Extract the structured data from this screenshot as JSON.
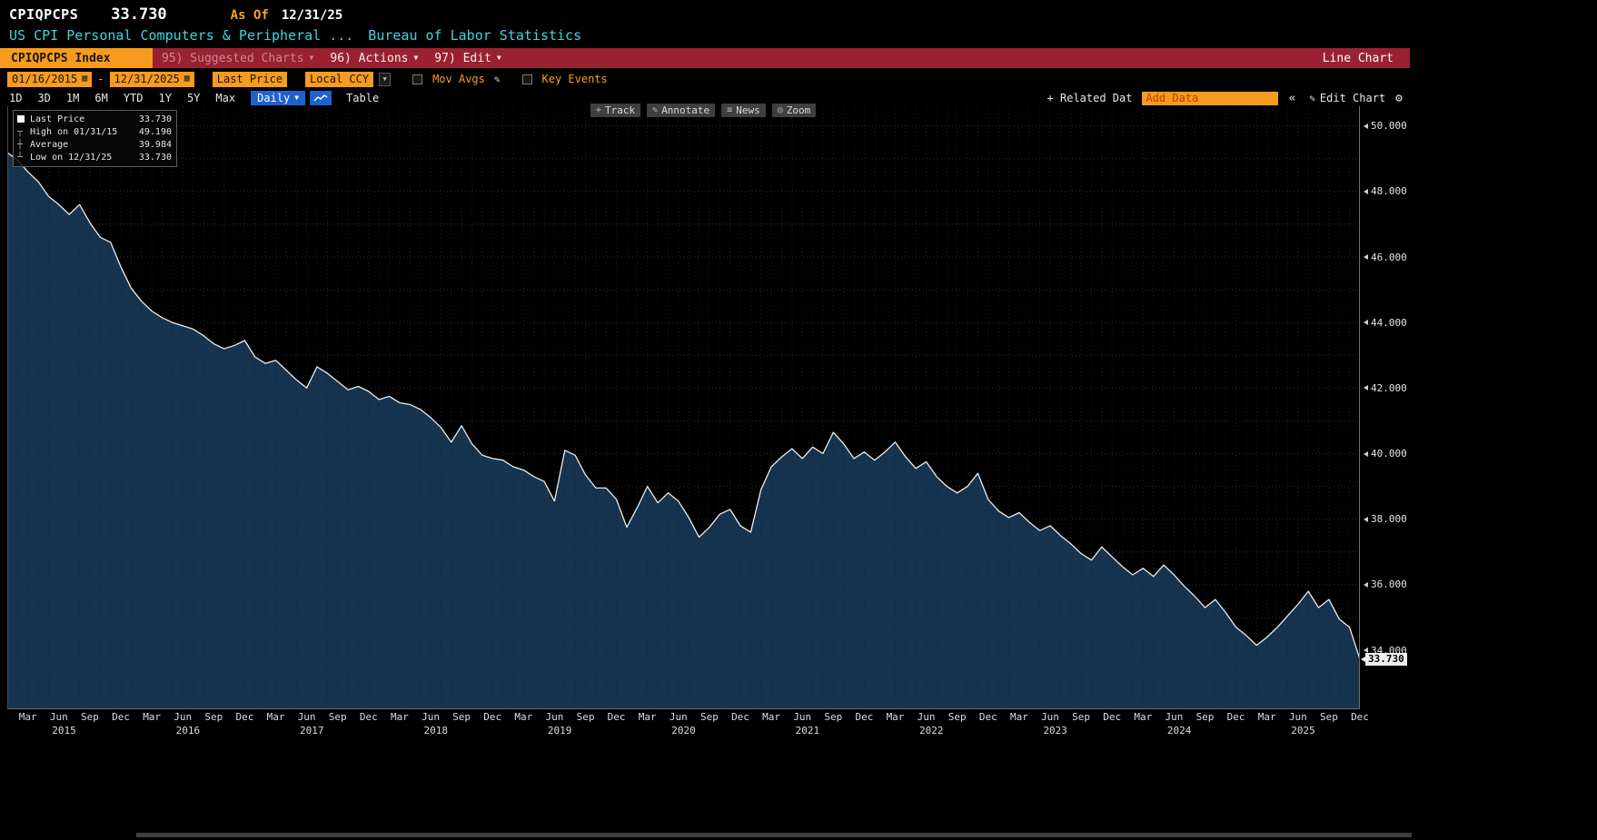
{
  "header": {
    "ticker": "CPIQPCPS",
    "last_value": "33.730",
    "as_of_label": "As Of",
    "as_of_date": "12/31/25",
    "description": "US CPI Personal Computers & Peripheral ...",
    "source": "Bureau of Labor Statistics"
  },
  "menu_bar": {
    "security_tab": "CPIQPCPS Index",
    "suggested_charts": "95) Suggested Charts",
    "actions": "96) Actions",
    "edit": "97) Edit",
    "chart_type_label": "Line Chart"
  },
  "toolbar": {
    "date_from": "01/16/2015",
    "date_separator": "-",
    "date_to": "12/31/2025",
    "field": "Last Price",
    "currency": "Local CCY",
    "mov_avgs_label": "Mov Avgs",
    "key_events_label": "Key Events"
  },
  "period_bar": {
    "ranges": [
      "1D",
      "3D",
      "1M",
      "6M",
      "YTD",
      "1Y",
      "5Y",
      "Max"
    ],
    "frequency": "Daily",
    "table_label": "Table",
    "related_data_label": "+ Related Dat",
    "add_data_placeholder": "Add Data",
    "edit_chart_label": "Edit Chart"
  },
  "chart_tools": [
    {
      "name": "track",
      "icon_glyph": "+",
      "label": "Track"
    },
    {
      "name": "annotate",
      "icon_glyph": "✎",
      "label": "Annotate"
    },
    {
      "name": "news",
      "icon_glyph": "≡",
      "label": "News"
    },
    {
      "name": "zoom",
      "icon_glyph": "◎",
      "label": "Zoom"
    }
  ],
  "legend": {
    "rows": [
      {
        "icon": "series-swatch",
        "icon_glyph": "",
        "label": "Last Price",
        "value": "33.730"
      },
      {
        "icon": "high-marker",
        "icon_glyph": "┬",
        "label": "High on 01/31/15",
        "value": "49.190"
      },
      {
        "icon": "average-marker",
        "icon_glyph": "┼",
        "label": "Average",
        "value": "39.984"
      },
      {
        "icon": "low-marker",
        "icon_glyph": "┴",
        "label": "Low on 12/31/25",
        "value": "33.730"
      }
    ]
  },
  "y_axis": {
    "ticks": [
      "50.000",
      "48.000",
      "46.000",
      "44.000",
      "42.000",
      "40.000",
      "38.000",
      "36.000",
      "34.000"
    ],
    "tick_values": [
      50,
      48,
      46,
      44,
      42,
      40,
      38,
      36,
      34
    ],
    "last_price_label": "33.730",
    "last_price_value": 33.73
  },
  "x_axis": {
    "quarter_labels": [
      "Mar",
      "Jun",
      "Sep",
      "Dec"
    ],
    "years": [
      "2015",
      "2016",
      "2017",
      "2018",
      "2019",
      "2020",
      "2021",
      "2022",
      "2023",
      "2024",
      "2025"
    ]
  },
  "chart_data": {
    "type": "area",
    "title": "",
    "xlabel": "",
    "ylabel": "",
    "x_start": "2015-01",
    "x_end": "2025-12",
    "sampling": "monthly",
    "ylim": [
      32.2,
      50.6
    ],
    "grid": "dotted",
    "legend_position": "top-left",
    "area_color": "#16344f",
    "line_color": "#ededed",
    "high": {
      "date": "01/31/15",
      "value": 49.19
    },
    "low": {
      "date": "12/31/25",
      "value": 33.73
    },
    "average": 39.984,
    "series": [
      {
        "name": "Last Price",
        "values": [
          49.19,
          48.95,
          48.6,
          48.3,
          47.85,
          47.6,
          47.3,
          47.6,
          47.05,
          46.6,
          46.45,
          45.7,
          45.05,
          44.65,
          44.35,
          44.15,
          44.0,
          43.9,
          43.8,
          43.6,
          43.35,
          43.2,
          43.3,
          43.45,
          42.95,
          42.75,
          42.85,
          42.55,
          42.25,
          42.0,
          42.65,
          42.45,
          42.2,
          41.95,
          42.05,
          41.9,
          41.65,
          41.75,
          41.55,
          41.5,
          41.35,
          41.1,
          40.8,
          40.35,
          40.85,
          40.3,
          39.95,
          39.85,
          39.8,
          39.6,
          39.5,
          39.3,
          39.15,
          38.55,
          40.1,
          39.95,
          39.35,
          38.95,
          38.95,
          38.6,
          37.75,
          38.35,
          39.0,
          38.5,
          38.8,
          38.55,
          38.05,
          37.45,
          37.75,
          38.15,
          38.3,
          37.8,
          37.6,
          38.9,
          39.6,
          39.9,
          40.15,
          39.85,
          40.2,
          40.0,
          40.65,
          40.3,
          39.85,
          40.05,
          39.8,
          40.05,
          40.35,
          39.9,
          39.55,
          39.75,
          39.3,
          39.0,
          38.8,
          39.0,
          39.4,
          38.6,
          38.25,
          38.05,
          38.2,
          37.9,
          37.65,
          37.8,
          37.5,
          37.25,
          36.95,
          36.75,
          37.15,
          36.85,
          36.55,
          36.3,
          36.5,
          36.25,
          36.6,
          36.3,
          35.95,
          35.65,
          35.3,
          35.55,
          35.15,
          34.7,
          34.45,
          34.15,
          34.4,
          34.7,
          35.05,
          35.4,
          35.8,
          35.3,
          35.55,
          34.95,
          34.7,
          33.73
        ]
      }
    ]
  },
  "icons": {
    "caret_down": "▼",
    "calendar": "▦",
    "pencil": "✎",
    "gear": "⚙",
    "collapse": "«"
  }
}
